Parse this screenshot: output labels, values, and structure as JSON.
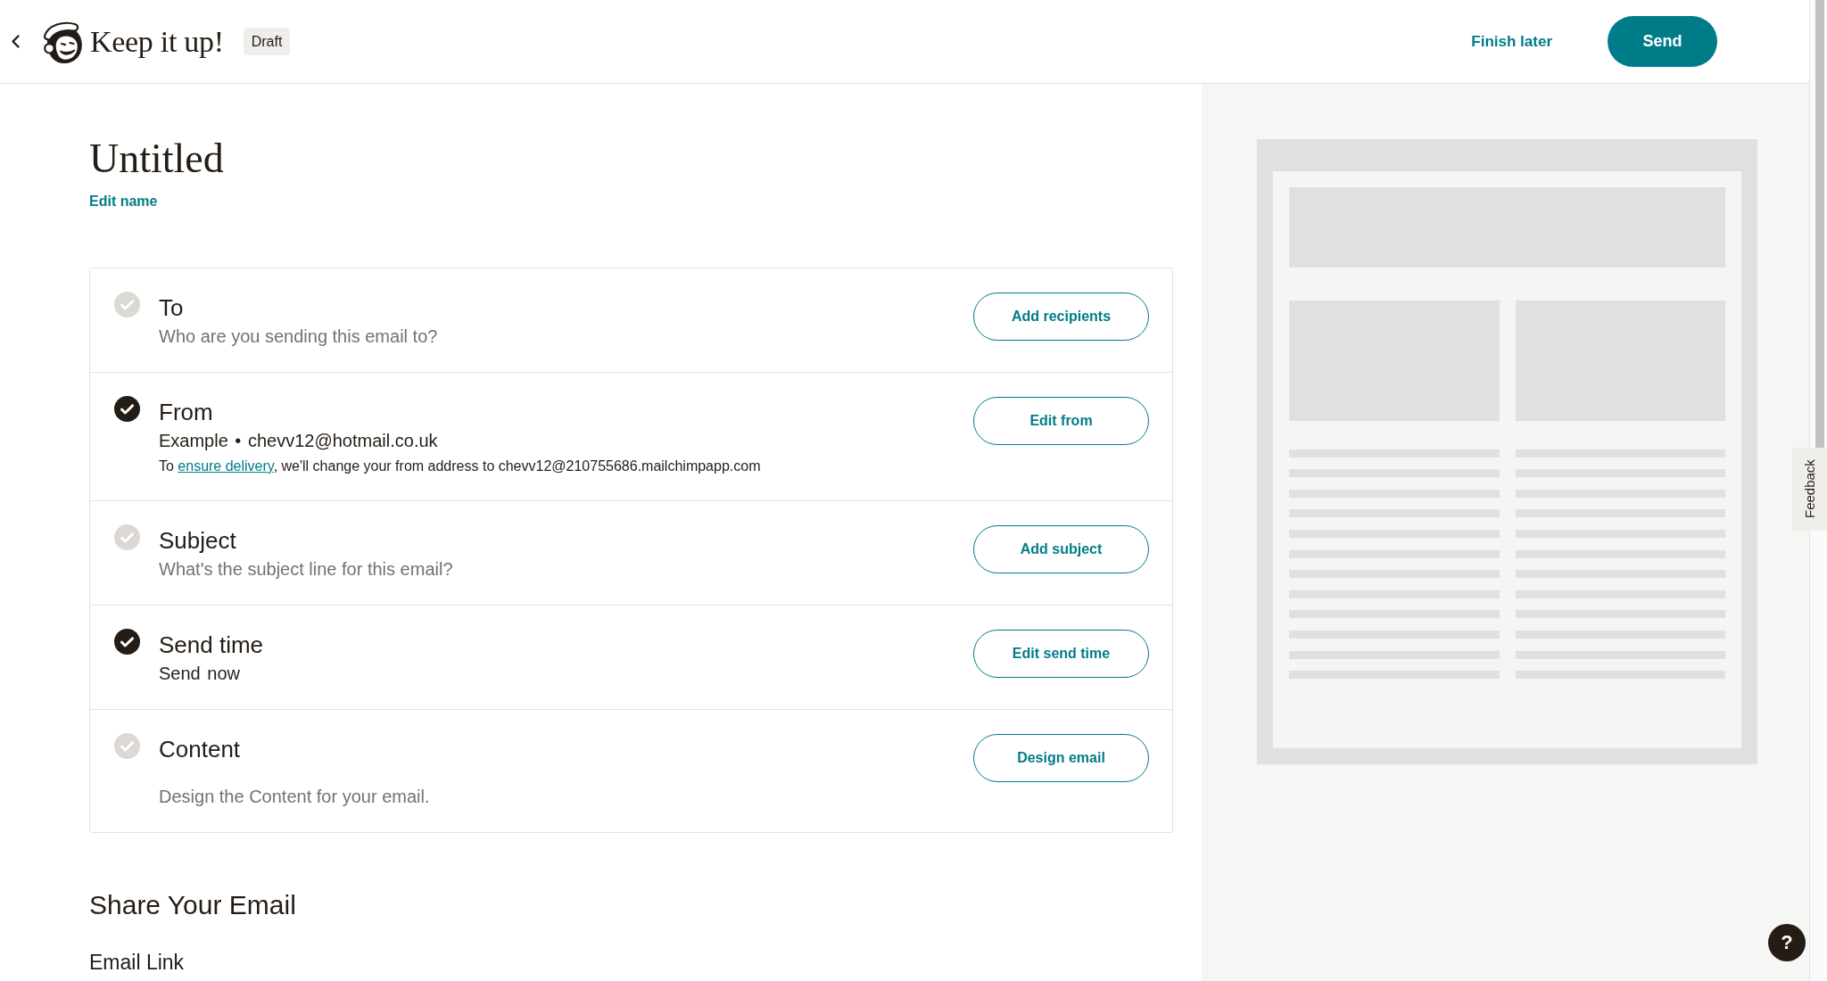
{
  "header": {
    "title": "Keep it up!",
    "badge": "Draft",
    "finish_later": "Finish later",
    "send_button": "Send"
  },
  "campaign": {
    "name": "Untitled",
    "edit_name": "Edit name"
  },
  "checklist": [
    {
      "title": "To",
      "checked": false,
      "lines": [
        {
          "kind": "prompt",
          "text": "Who are you sending this email to?"
        }
      ],
      "button": "Add recipients"
    },
    {
      "title": "From",
      "checked": true,
      "lines": [
        {
          "kind": "value",
          "text": "Example • chevv12@hotmail.co.uk"
        },
        {
          "kind": "note",
          "text_before": "To ",
          "link": "ensure delivery",
          "text_after": ", we'll change your from address to chevv12@210755686.mailchimpapp.com"
        }
      ],
      "button": "Edit from"
    },
    {
      "title": "Subject",
      "checked": false,
      "lines": [
        {
          "kind": "prompt",
          "text": "What's the subject line for this email?"
        }
      ],
      "button": "Add subject"
    },
    {
      "title": "Send time",
      "checked": true,
      "lines": [
        {
          "kind": "value",
          "text": "Send now"
        }
      ],
      "button": "Edit send time"
    },
    {
      "title": "Content",
      "checked": false,
      "lines": [
        {
          "kind": "prompt",
          "text": "Design the Content for your email."
        }
      ],
      "button": "Design email"
    }
  ],
  "share": {
    "heading": "Share Your Email",
    "email_link_heading": "Email Link"
  },
  "feedback_tab": "Feedback",
  "help_button": "?"
}
